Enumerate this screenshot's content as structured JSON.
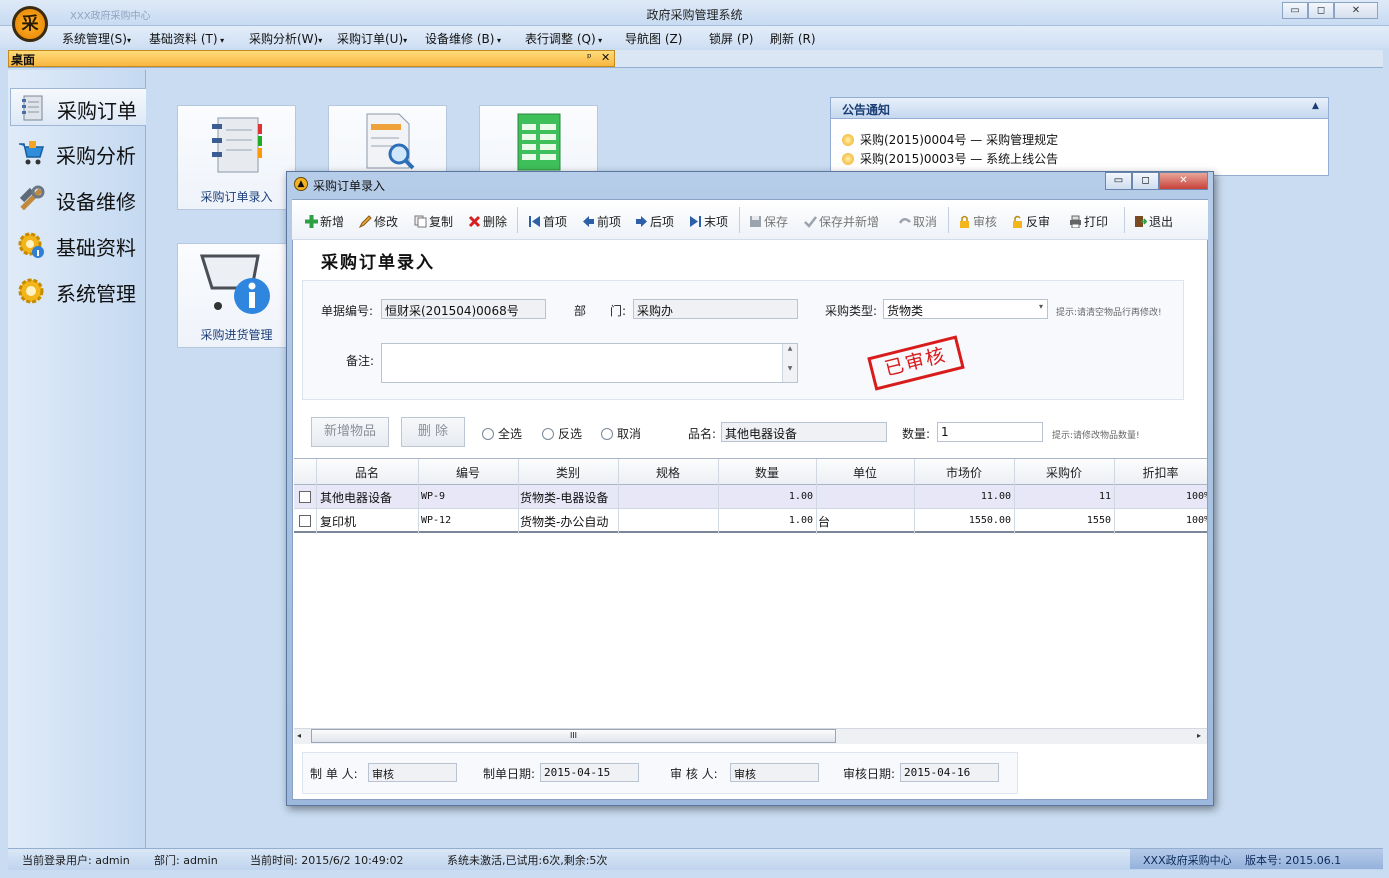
{
  "app": {
    "title": "政府采购管理系统",
    "logo_char": "采",
    "ghost_title": "XXX政府采购中心",
    "win_min": "▭",
    "win_max": "◻",
    "win_close": "✕"
  },
  "menu": [
    "系统管理(S)",
    "基础资料 (T)",
    "采购分析(W)",
    "采购订单(U)",
    "设备维修 (B)",
    "表行调整 (Q)",
    "导航图 (Z)",
    "锁屏 (P)",
    "刷新 (R)"
  ],
  "menu_arrow": "▾",
  "doctab": {
    "label": "桌面",
    "pin": "ᵖ",
    "close": "✕"
  },
  "sidebar": {
    "items": [
      "采购订单",
      "采购分析",
      "设备维修",
      "基础资料",
      "系统管理"
    ]
  },
  "tiles": [
    "采购订单录入",
    "",
    "",
    "采购进货管理"
  ],
  "notice": {
    "title": "公告通知",
    "collapse": "▲",
    "items": [
      "采购(2015)0004号 — 采购管理规定",
      "采购(2015)0003号 — 系统上线公告"
    ]
  },
  "dialog": {
    "title": "采购订单录入",
    "icon": "▲",
    "toolbar": [
      "新增",
      "修改",
      "复制",
      "删除",
      "首项",
      "前项",
      "后项",
      "末项",
      "保存",
      "保存并新增",
      "取消",
      "审核",
      "反审",
      "打印",
      "退出"
    ],
    "form_title": "采购订单录入",
    "fields": {
      "doc_no_label": "单据编号:",
      "doc_no": "恒财采(201504)0068号",
      "dept_label": "部　　门:",
      "dept": "采购办",
      "type_label": "采购类型:",
      "type": "货物类",
      "type_hint": "提示:请清空物品行再修改!",
      "remark_label": "备注:",
      "remark": ""
    },
    "stamp": "已审核",
    "buttons": {
      "add_item": "新增物品",
      "delete": "删 除"
    },
    "radios": [
      "全选",
      "反选",
      "取消"
    ],
    "item_name_label": "品名:",
    "item_name": "其他电器设备",
    "qty_label": "数量:",
    "qty": "1",
    "qty_hint": "提示:请修改物品数量!",
    "columns": [
      "品名",
      "编号",
      "类别",
      "规格",
      "数量",
      "单位",
      "市场价",
      "采购价",
      "折扣率"
    ],
    "rows": [
      [
        "其他电器设备",
        "WP-9",
        "货物类-电器设备",
        "",
        "1.00",
        "",
        "11.00",
        "11",
        "100%"
      ],
      [
        "复印机",
        "WP-12",
        "货物类-办公自动",
        "",
        "1.00",
        "台",
        "1550.00",
        "1550",
        "100%"
      ]
    ],
    "scroll_grip": "III",
    "footer": {
      "maker_label": "制 单 人:",
      "maker": "审核",
      "make_date_label": "制单日期:",
      "make_date": "2015-04-15",
      "auditor_label": "审 核 人:",
      "auditor": "审核",
      "audit_date_label": "审核日期:",
      "audit_date": "2015-04-16"
    }
  },
  "status": {
    "user": "当前登录用户: admin",
    "dept": "部门: admin",
    "time": "当前时间: 2015/6/2 10:49:02",
    "trial": "系统未激活,已试用:6次,剩余:5次",
    "org": "XXX政府采购中心",
    "version": "版本号: 2015.06.1"
  },
  "colors": {
    "accent": "#f8b640",
    "window_bg": "#c9dcf2",
    "stamp": "#d81c1c"
  }
}
